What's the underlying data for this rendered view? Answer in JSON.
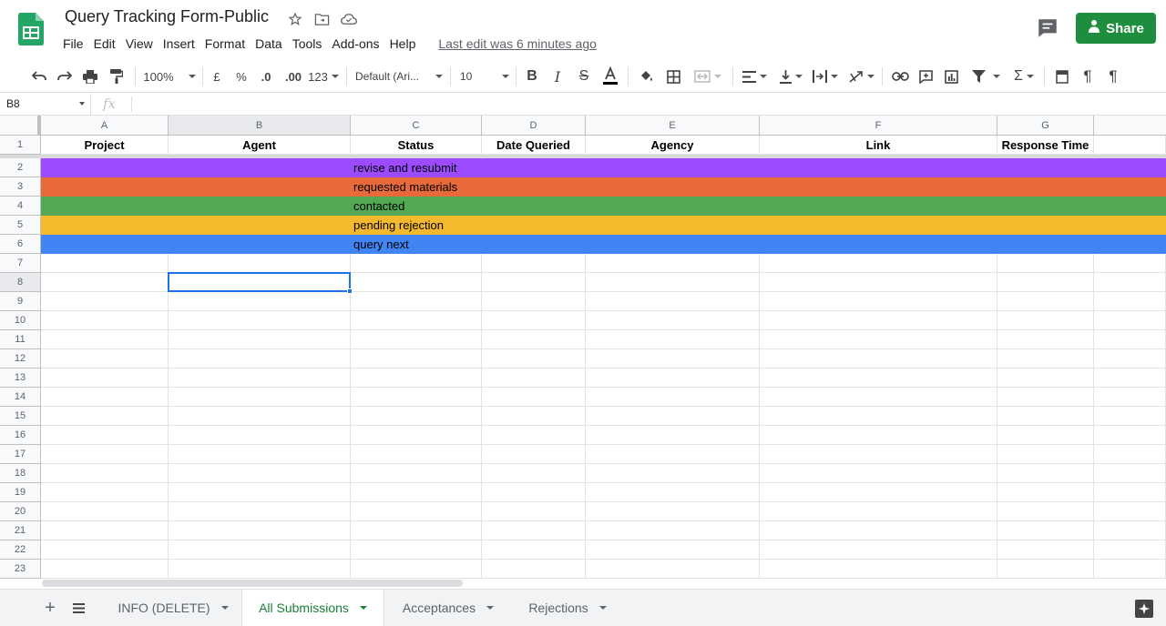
{
  "app": {
    "doc_title": "Query Tracking Form-Public",
    "last_edit": "Last edit was 6 minutes ago",
    "share_label": "Share"
  },
  "menu": [
    "File",
    "Edit",
    "View",
    "Insert",
    "Format",
    "Data",
    "Tools",
    "Add-ons",
    "Help"
  ],
  "toolbar": {
    "zoom": "100%",
    "currency": "£",
    "percent": "%",
    "dec_decrease": ".0",
    "dec_increase": ".00",
    "more_formats": "123",
    "font": "Default (Ari...",
    "font_size": "10"
  },
  "formula_bar": {
    "cell_ref": "B8",
    "fx": "fx",
    "value": ""
  },
  "columns": [
    "A",
    "B",
    "C",
    "D",
    "E",
    "F",
    "G"
  ],
  "header_row": [
    "Project",
    "Agent",
    "Status",
    "Date Queried",
    "Agency",
    "Link",
    "Response Time"
  ],
  "status_rows": [
    {
      "label": "revise and resubmit",
      "color": "#9c4bff"
    },
    {
      "label": "requested materials",
      "color": "#e8693a"
    },
    {
      "label": "contacted",
      "color": "#52a853"
    },
    {
      "label": "pending rejection",
      "color": "#f5b92e"
    },
    {
      "label": "query next",
      "color": "#4184f3"
    }
  ],
  "row_numbers": [
    "1",
    "2",
    "3",
    "4",
    "5",
    "6",
    "7",
    "8",
    "9",
    "10",
    "11",
    "12",
    "13",
    "14",
    "15",
    "16",
    "17",
    "18",
    "19",
    "20",
    "21",
    "22",
    "23"
  ],
  "selected_cell": "B8",
  "sheets": [
    {
      "label": "INFO (DELETE)",
      "active": false
    },
    {
      "label": "All Submissions",
      "active": true
    },
    {
      "label": "Acceptances",
      "active": false
    },
    {
      "label": "Rejections",
      "active": false
    }
  ],
  "colors": {
    "share_green": "#1e8e3e",
    "active_tab_green": "#188038",
    "selection_blue": "#1a73e8"
  }
}
